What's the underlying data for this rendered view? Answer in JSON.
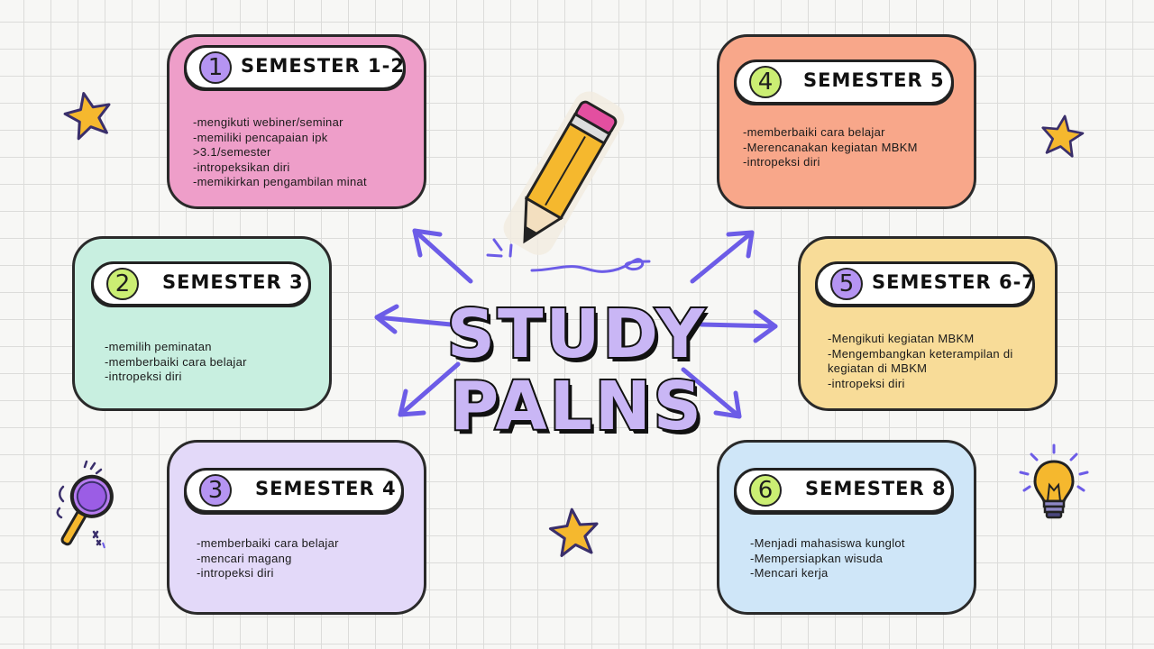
{
  "title": {
    "line1": "STUDY",
    "line2": "PALNS"
  },
  "colors": {
    "arrow": "#6c5ce7",
    "star": "#f5b82e",
    "card1": "#ee9ec9",
    "underline1": "#9ee5e2",
    "card2": "#c8efe0",
    "underline2": "#f08a5d",
    "card3": "#e3d9f9",
    "underline3": "#f5c04a",
    "card4": "#f8a78a",
    "underline4": "#a9dcef",
    "card5": "#f8dc98",
    "underline5": "#d4b8f5",
    "card6": "#cfe6f8",
    "underline6": "#f6cf86"
  },
  "nodes": [
    {
      "number": "1",
      "label": "SEMESTER 1-2",
      "items": [
        "-mengikuti webiner/seminar",
        "-memiliki pencapaian ipk",
        ">3.1/semester",
        "-intropeksikan diri",
        "-memikirkan pengambilan minat"
      ]
    },
    {
      "number": "2",
      "label": "SEMESTER 3",
      "items": [
        "-memilih peminatan",
        "-memberbaiki cara belajar",
        "-intropeksi diri"
      ]
    },
    {
      "number": "3",
      "label": "SEMESTER 4",
      "items": [
        "-memberbaiki cara belajar",
        "-mencari magang",
        "-intropeksi diri"
      ]
    },
    {
      "number": "4",
      "label": "SEMESTER 5",
      "items": [
        "-memberbaiki cara belajar",
        "-Merencanakan kegiatan MBKM",
        "-intropeksi diri"
      ]
    },
    {
      "number": "5",
      "label": "SEMESTER 6-7",
      "items": [
        "-Mengikuti kegiatan MBKM",
        "-Mengembangkan keterampilan di",
        "kegiatan di MBKM",
        "-intropeksi diri"
      ]
    },
    {
      "number": "6",
      "label": "SEMESTER 8",
      "items": [
        "-Menjadi mahasiswa kunglot",
        "-Mempersiapkan wisuda",
        "-Mencari kerja"
      ]
    }
  ],
  "icons": [
    "pencil-icon",
    "star-icon",
    "magnifier-icon",
    "lightbulb-icon",
    "arrow-icon"
  ]
}
